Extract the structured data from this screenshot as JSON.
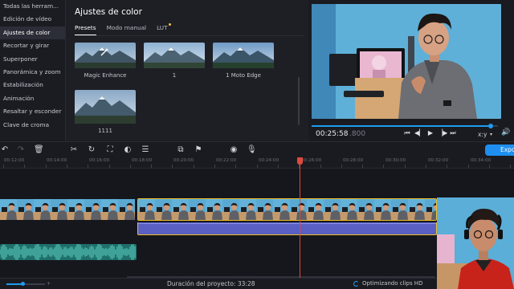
{
  "sidebar": {
    "items": [
      {
        "label": "Todas las herram..."
      },
      {
        "label": "Edición de vídeo"
      },
      {
        "label": "Ajustes de color"
      },
      {
        "label": "Recortar y girar"
      },
      {
        "label": "Superponer"
      },
      {
        "label": "Panorámica y zoom"
      },
      {
        "label": "Estabilización"
      },
      {
        "label": "Animación"
      },
      {
        "label": "Resaltar y esconder"
      },
      {
        "label": "Clave de croma"
      }
    ],
    "active_index": 2
  },
  "panel": {
    "title": "Ajustes de color",
    "tabs": [
      {
        "label": "Presets"
      },
      {
        "label": "Modo manual"
      },
      {
        "label": "LUT"
      }
    ],
    "presets": [
      {
        "label": "Magic Enhance"
      },
      {
        "label": "1"
      },
      {
        "label": "1 Moto Edge"
      },
      {
        "label": "1111"
      }
    ]
  },
  "preview": {
    "time_current": "00:25:58",
    "time_ms": ".800",
    "progress": 0.96,
    "ratio": "x:y",
    "ratio_chevron": "▾",
    "controls": {
      "prev_icon": "⏮",
      "back_icon": "◀▏",
      "play_icon": "▶",
      "fwd_icon": "▕▶",
      "next_icon": "⏭",
      "volume_icon": "🔊"
    }
  },
  "toolbar": {
    "undo_icon": "↶",
    "redo_icon": "↷",
    "delete_icon": "🗑",
    "cut_icon": "✂",
    "rotate_icon": "↻",
    "crop_icon": "⛶",
    "color_icon": "◐",
    "settings_icon": "☰",
    "overlay_icon": "⧉",
    "marker_icon": "⚑",
    "record_icon": "◉",
    "mic_icon": "🎙",
    "export_label": "Exportar"
  },
  "ruler": {
    "labels": [
      "00:12:00",
      "00:14:00",
      "00:16:00",
      "00:18:00",
      "00:20:00",
      "00:22:00",
      "00:24:00",
      "00:26:00",
      "00:28:00",
      "00:30:00",
      "00:32:00",
      "00:34:00"
    ]
  },
  "status": {
    "duration_label": "Duración del proyecto: 33:28",
    "optimizing_label": "Optimizando clips HD",
    "zoom_level": 0.45,
    "zoom_plus": "+"
  },
  "colors": {
    "accent": "#1e9cf0",
    "selection": "#f0c02a",
    "color_track": "#5a5fc4",
    "audio_track": "#1f6f6a",
    "playhead": "#e0483e"
  }
}
